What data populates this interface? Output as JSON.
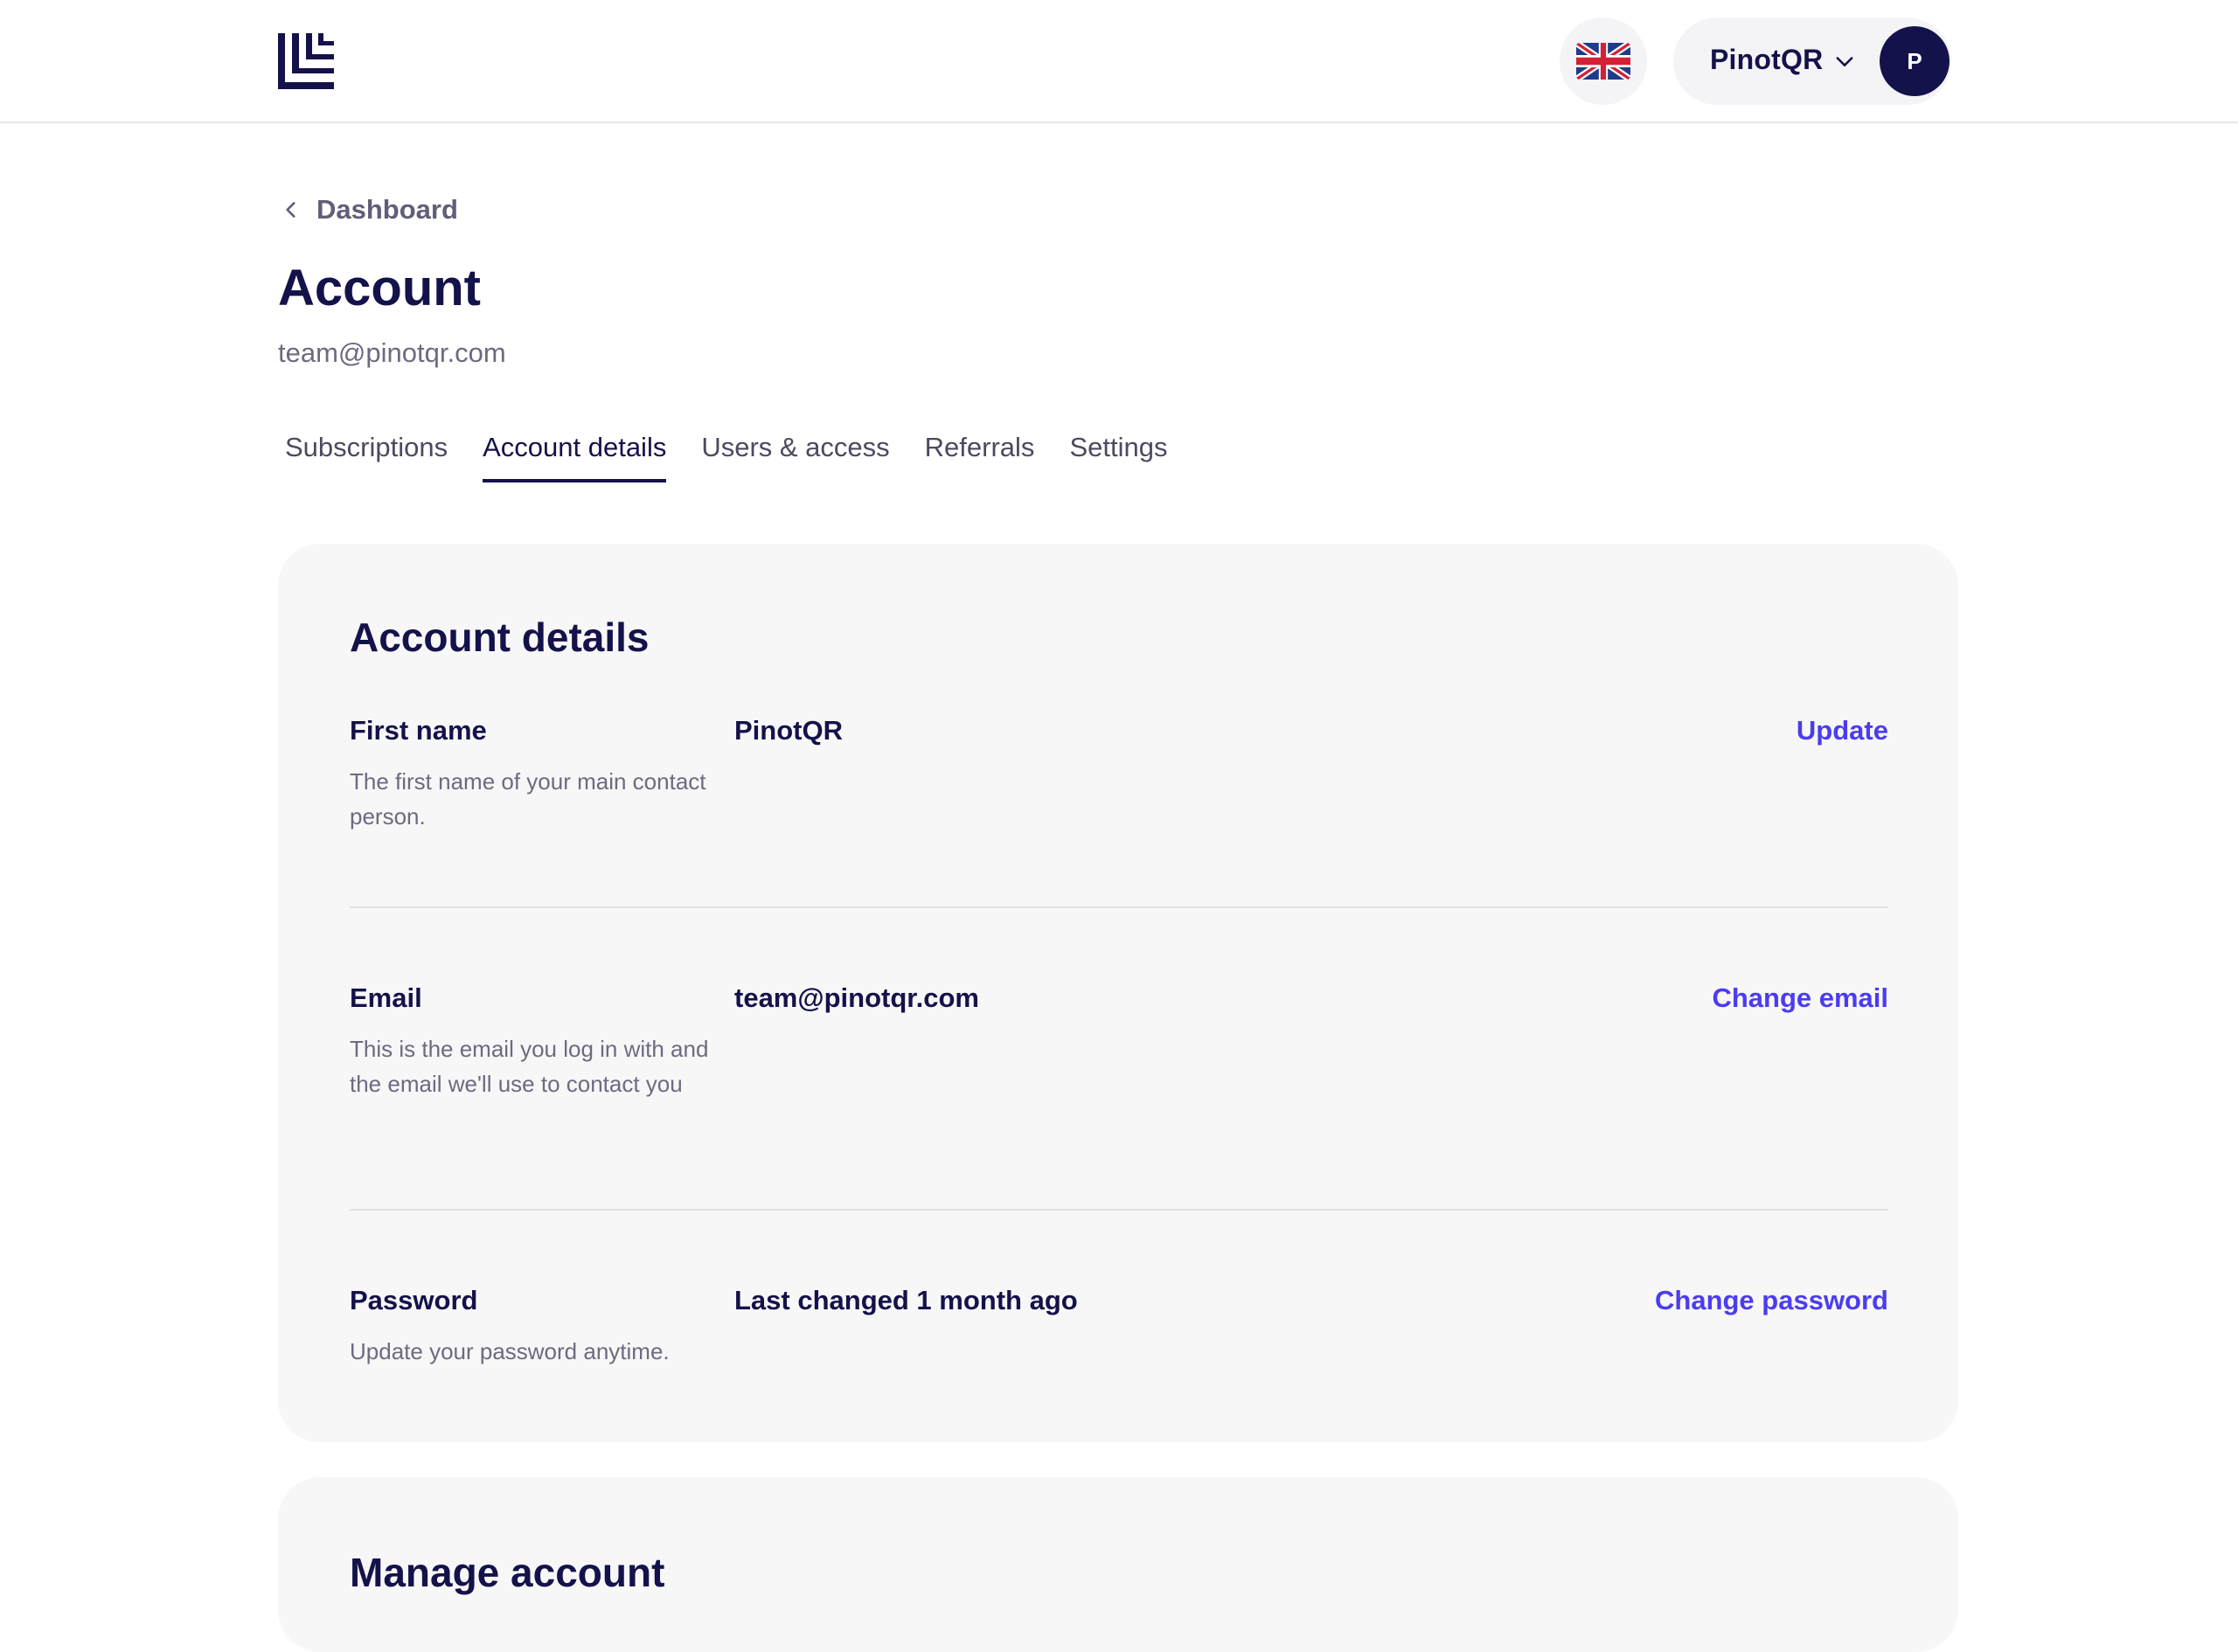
{
  "header": {
    "logo_icon": "stacked-lines-logo",
    "language_icon": "uk-flag-icon",
    "user_name": "PinotQR",
    "user_avatar_initial": "P"
  },
  "breadcrumb": {
    "back_label": "Dashboard"
  },
  "page": {
    "title": "Account",
    "email": "team@pinotqr.com"
  },
  "tabs": [
    {
      "label": "Subscriptions",
      "active": false
    },
    {
      "label": "Account details",
      "active": true
    },
    {
      "label": "Users & access",
      "active": false
    },
    {
      "label": "Referrals",
      "active": false
    },
    {
      "label": "Settings",
      "active": false
    }
  ],
  "account_details": {
    "title": "Account details",
    "rows": [
      {
        "label": "First name",
        "description": "The first name of your main contact person.",
        "value": "PinotQR",
        "action": "Update"
      },
      {
        "label": "Email",
        "description": "This is the email you log in with and the email we'll use to contact you",
        "value": "team@pinotqr.com",
        "action": "Change email"
      },
      {
        "label": "Password",
        "description": "Update your password anytime.",
        "value": "Last changed 1 month ago",
        "action": "Change password"
      }
    ]
  },
  "manage_account": {
    "title": "Manage account"
  },
  "colors": {
    "primary_text": "#14124a",
    "link": "#4b3cf0",
    "muted_text": "#6b6b80",
    "card_background": "#f7f7f8"
  }
}
